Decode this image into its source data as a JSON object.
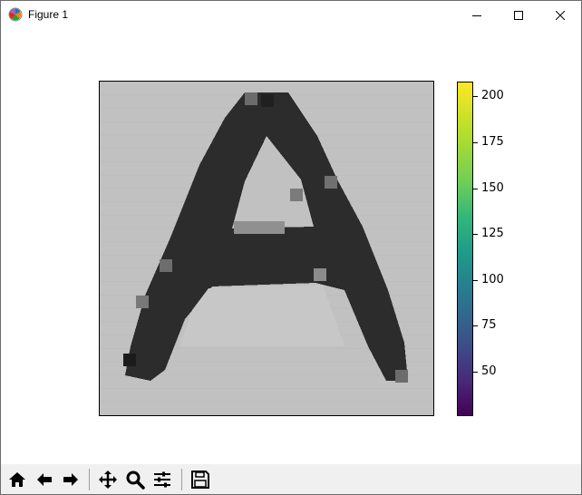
{
  "window": {
    "title": "Figure 1",
    "icon": "matplotlib-logo-icon",
    "controls": [
      "minimize-icon",
      "maximize-icon",
      "close-icon"
    ]
  },
  "figure": {
    "image": {
      "subject": "letter-a-grayscale-pixels",
      "background_color": "#c0c1c0",
      "ink_color": "#2a2b2a"
    },
    "colorbar": {
      "colormap": "viridis",
      "range": [
        27,
        208
      ],
      "ticks": [
        "50",
        "75",
        "100",
        "125",
        "150",
        "175",
        "200"
      ]
    }
  },
  "toolbar": {
    "buttons": [
      "home-icon",
      "back-icon",
      "forward-icon",
      "pan-icon",
      "zoom-icon",
      "configure-subplots-icon",
      "save-icon"
    ]
  }
}
